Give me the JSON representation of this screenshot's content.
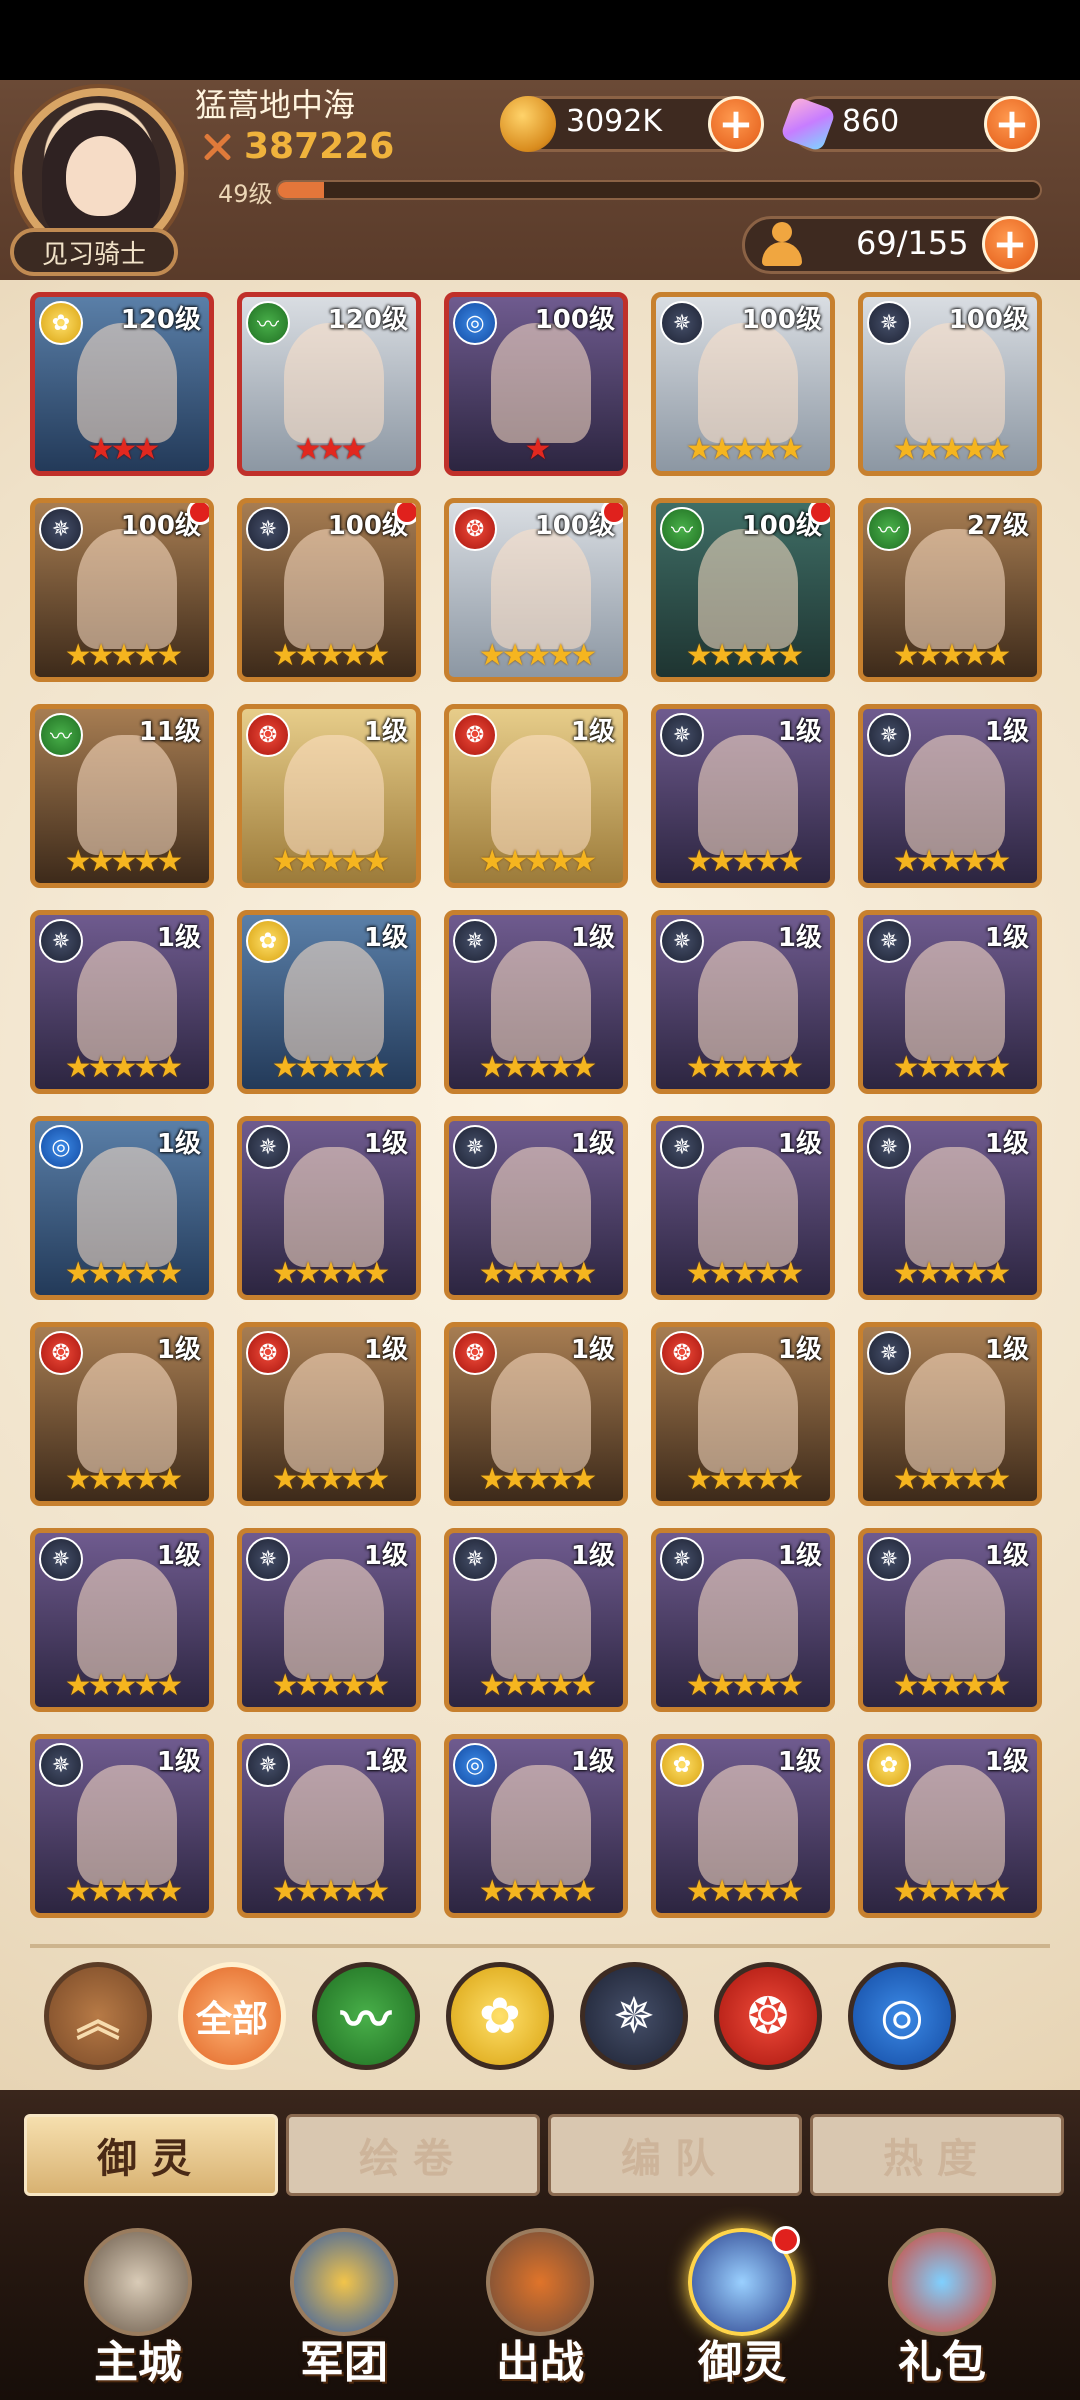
{
  "player": {
    "name": "猛蒿地中海",
    "power": "387226",
    "level": "49级",
    "level_progress": 0.06,
    "rank": "见习骑士"
  },
  "resources": {
    "gold": "3092K",
    "gems": "860",
    "troops": "69/155",
    "plus": "+"
  },
  "colors": {
    "accent": "#e25a16",
    "card_border": "#c7802e",
    "card_border_red": "#c0302a",
    "star": "#f5b51f",
    "bg": "#f3e6cf"
  },
  "elements": {
    "wind": "wind-element-icon",
    "light": "light-element-icon",
    "dark": "dark-element-icon",
    "fire": "fire-element-icon",
    "water": "water-element-icon"
  },
  "heroes": [
    {
      "level": "120级",
      "element": "light",
      "stars": 3,
      "star_color": "red",
      "border": "red",
      "bg": "blue",
      "dot": false
    },
    {
      "level": "120级",
      "element": "wind",
      "stars": 3,
      "star_color": "red",
      "border": "red",
      "bg": "gray",
      "dot": false
    },
    {
      "level": "100级",
      "element": "water",
      "stars": 1,
      "star_color": "red",
      "border": "red",
      "bg": "purple",
      "dot": false
    },
    {
      "level": "100级",
      "element": "dark",
      "stars": 5,
      "star_color": "gold",
      "border": "gold",
      "bg": "gray",
      "dot": false
    },
    {
      "level": "100级",
      "element": "dark",
      "stars": 5,
      "star_color": "gold",
      "border": "gold",
      "bg": "gray",
      "dot": false
    },
    {
      "level": "100级",
      "element": "dark",
      "stars": 5,
      "star_color": "gold",
      "border": "gold",
      "bg": "brown",
      "dot": true
    },
    {
      "level": "100级",
      "element": "dark",
      "stars": 5,
      "star_color": "gold",
      "border": "gold",
      "bg": "brown",
      "dot": true
    },
    {
      "level": "100级",
      "element": "fire",
      "stars": 5,
      "star_color": "gold",
      "border": "gold",
      "bg": "gray",
      "dot": true
    },
    {
      "level": "100级",
      "element": "wind",
      "stars": 5,
      "star_color": "gold",
      "border": "gold",
      "bg": "teal",
      "dot": true
    },
    {
      "level": "27级",
      "element": "wind",
      "stars": 5,
      "star_color": "gold",
      "border": "gold",
      "bg": "brown",
      "dot": false
    },
    {
      "level": "11级",
      "element": "wind",
      "stars": 5,
      "star_color": "gold",
      "border": "gold",
      "bg": "brown",
      "dot": false
    },
    {
      "level": "1级",
      "element": "fire",
      "stars": 5,
      "star_color": "gold",
      "border": "gold",
      "bg": "gold",
      "dot": false
    },
    {
      "level": "1级",
      "element": "fire",
      "stars": 5,
      "star_color": "gold",
      "border": "gold",
      "bg": "gold",
      "dot": false
    },
    {
      "level": "1级",
      "element": "dark",
      "stars": 5,
      "star_color": "gold",
      "border": "gold",
      "bg": "purple",
      "dot": false
    },
    {
      "level": "1级",
      "element": "dark",
      "stars": 5,
      "star_color": "gold",
      "border": "gold",
      "bg": "purple",
      "dot": false
    },
    {
      "level": "1级",
      "element": "dark",
      "stars": 5,
      "star_color": "gold",
      "border": "gold",
      "bg": "purple",
      "dot": false
    },
    {
      "level": "1级",
      "element": "light",
      "stars": 5,
      "star_color": "gold",
      "border": "gold",
      "bg": "blue",
      "dot": false
    },
    {
      "level": "1级",
      "element": "dark",
      "stars": 5,
      "star_color": "gold",
      "border": "gold",
      "bg": "purple",
      "dot": false
    },
    {
      "level": "1级",
      "element": "dark",
      "stars": 5,
      "star_color": "gold",
      "border": "gold",
      "bg": "purple",
      "dot": false
    },
    {
      "level": "1级",
      "element": "dark",
      "stars": 5,
      "star_color": "gold",
      "border": "gold",
      "bg": "purple",
      "dot": false
    },
    {
      "level": "1级",
      "element": "water",
      "stars": 5,
      "star_color": "gold",
      "border": "gold",
      "bg": "blue",
      "dot": false
    },
    {
      "level": "1级",
      "element": "dark",
      "stars": 5,
      "star_color": "gold",
      "border": "gold",
      "bg": "purple",
      "dot": false
    },
    {
      "level": "1级",
      "element": "dark",
      "stars": 5,
      "star_color": "gold",
      "border": "gold",
      "bg": "purple",
      "dot": false
    },
    {
      "level": "1级",
      "element": "dark",
      "stars": 5,
      "star_color": "gold",
      "border": "gold",
      "bg": "purple",
      "dot": false
    },
    {
      "level": "1级",
      "element": "dark",
      "stars": 5,
      "star_color": "gold",
      "border": "gold",
      "bg": "purple",
      "dot": false
    },
    {
      "level": "1级",
      "element": "fire",
      "stars": 5,
      "star_color": "gold",
      "border": "gold",
      "bg": "brown",
      "dot": false
    },
    {
      "level": "1级",
      "element": "fire",
      "stars": 5,
      "star_color": "gold",
      "border": "gold",
      "bg": "brown",
      "dot": false
    },
    {
      "level": "1级",
      "element": "fire",
      "stars": 5,
      "star_color": "gold",
      "border": "gold",
      "bg": "brown",
      "dot": false
    },
    {
      "level": "1级",
      "element": "fire",
      "stars": 5,
      "star_color": "gold",
      "border": "gold",
      "bg": "brown",
      "dot": false
    },
    {
      "level": "1级",
      "element": "dark",
      "stars": 5,
      "star_color": "gold",
      "border": "gold",
      "bg": "brown",
      "dot": false
    },
    {
      "level": "1级",
      "element": "dark",
      "stars": 5,
      "star_color": "gold",
      "border": "gold",
      "bg": "purple",
      "dot": false
    },
    {
      "level": "1级",
      "element": "dark",
      "stars": 5,
      "star_color": "gold",
      "border": "gold",
      "bg": "purple",
      "dot": false
    },
    {
      "level": "1级",
      "element": "dark",
      "stars": 5,
      "star_color": "gold",
      "border": "gold",
      "bg": "purple",
      "dot": false
    },
    {
      "level": "1级",
      "element": "dark",
      "stars": 5,
      "star_color": "gold",
      "border": "gold",
      "bg": "purple",
      "dot": false
    },
    {
      "level": "1级",
      "element": "dark",
      "stars": 5,
      "star_color": "gold",
      "border": "gold",
      "bg": "purple",
      "dot": false
    },
    {
      "level": "1级",
      "element": "dark",
      "stars": 5,
      "star_color": "gold",
      "border": "gold",
      "bg": "purple",
      "dot": false
    },
    {
      "level": "1级",
      "element": "dark",
      "stars": 5,
      "star_color": "gold",
      "border": "gold",
      "bg": "purple",
      "dot": false
    },
    {
      "level": "1级",
      "element": "water",
      "stars": 5,
      "star_color": "gold",
      "border": "gold",
      "bg": "purple",
      "dot": false
    },
    {
      "level": "1级",
      "element": "light",
      "stars": 5,
      "star_color": "gold",
      "border": "gold",
      "bg": "purple",
      "dot": false
    },
    {
      "level": "1级",
      "element": "light",
      "stars": 5,
      "star_color": "gold",
      "border": "gold",
      "bg": "purple",
      "dot": false
    }
  ],
  "filters": {
    "collapse_icon": "chevron-up-icon",
    "all_label": "全部",
    "elements": [
      "wind",
      "light",
      "dark",
      "fire",
      "water"
    ]
  },
  "subtabs": [
    "御灵",
    "绘卷",
    "编队",
    "热度"
  ],
  "nav": [
    {
      "label": "主城",
      "icon": "castle-icon",
      "active": false
    },
    {
      "label": "军团",
      "icon": "legion-shield-icon",
      "active": false
    },
    {
      "label": "出战",
      "icon": "battle-gate-icon",
      "active": false
    },
    {
      "label": "御灵",
      "icon": "spirit-crystal-icon",
      "active": true
    },
    {
      "label": "礼包",
      "icon": "gift-shop-icon",
      "active": false
    }
  ]
}
